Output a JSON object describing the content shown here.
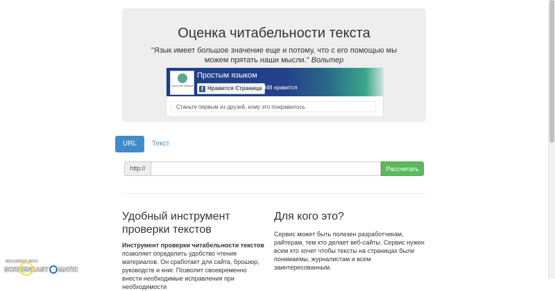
{
  "header": {
    "title": "Оценка читабельности текста",
    "quote": "\"Язык имеет большое значение еще и потому, что с его помощью мы можем прятать наши мысли.\"",
    "quote_author": "Вольтер"
  },
  "fb_widget": {
    "page_name": "Простым языком",
    "logo_text": "Простым языком",
    "like_button": "Нравится Страница",
    "like_count": "948 нравится",
    "social_text": "Станьте первым из друзей, кому это понравилось.",
    "logo_icon": "leaf-icon",
    "fb_icon": "facebook-f-icon"
  },
  "tabs": [
    {
      "label": "URL",
      "active": true
    },
    {
      "label": "Текст",
      "active": false
    }
  ],
  "url_form": {
    "prefix": "http://",
    "value": "",
    "button": "Рассчитать"
  },
  "left_col": {
    "heading": "Удобный инструмент проверки текстов",
    "bold": "Инструмент проверки читабельности текстов",
    "text": " позволяет определить удобство чтения материалов. Он сработает для сайта, брошюр, руководств и книг. Позволит своевременно внести необходимые исправления при необходимости"
  },
  "right_col": {
    "heading": "Для кого это?",
    "text": "Сервис может быть полезен разработчикам, райтерам, тем кто делает веб-сайты. Сервис нужен всем кто хочет чтобы тексты на страницах были понимаемы, журналистам и всем заинтересованным."
  },
  "watermark": {
    "small": "RECORDED WITH",
    "part1": "SCREENCAST",
    "part2": "MATIC"
  },
  "colors": {
    "primary": "#428bca",
    "success": "#5cb85c",
    "jumbotron": "#eeeeee"
  }
}
